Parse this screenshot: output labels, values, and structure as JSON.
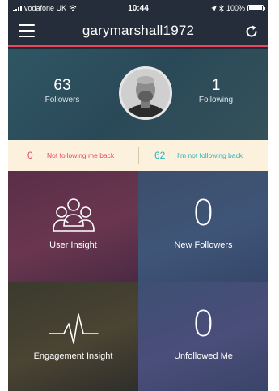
{
  "status_bar": {
    "carrier": "vodafone UK",
    "time": "10:44",
    "battery": "100%"
  },
  "header": {
    "title": "garymarshall1972"
  },
  "profile": {
    "followers": {
      "count": "63",
      "label": "Followers"
    },
    "following": {
      "count": "1",
      "label": "Following"
    }
  },
  "strip": {
    "not_following_back": {
      "count": "0",
      "label": "Not following me back"
    },
    "im_not_following_back": {
      "count": "62",
      "label": "I'm not following back"
    }
  },
  "tiles": {
    "user_insight": {
      "label": "User Insight",
      "icon": "users-group-icon"
    },
    "new_followers": {
      "value": "0",
      "label": "New Followers"
    },
    "engagement_insight": {
      "label": "Engagement Insight",
      "icon": "pulse-line-icon"
    },
    "unfollowed_me": {
      "value": "0",
      "label": "Unfollowed Me"
    }
  },
  "colors": {
    "accent_red": "#e8485c",
    "accent_teal": "#28b2b8",
    "strip_bg": "#fbf1dd",
    "header_bg": "#252d3a"
  }
}
